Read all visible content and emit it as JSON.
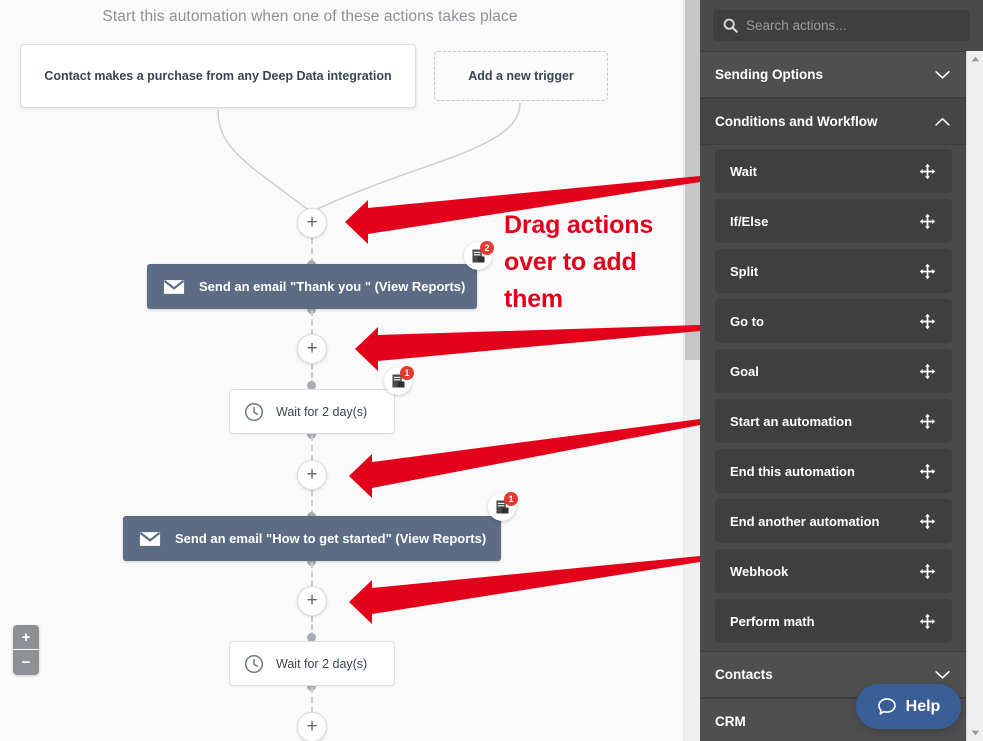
{
  "canvas": {
    "header": "Start this automation when one of these actions takes place",
    "triggers": [
      {
        "label": "Contact makes a purchase from any Deep Data integration",
        "style": "solid"
      },
      {
        "label": "Add a new trigger",
        "style": "dashed"
      }
    ],
    "nodes": [
      {
        "type": "email",
        "label": "Send an email \"Thank you \" (View Reports)",
        "reports": "2"
      },
      {
        "type": "wait",
        "label": "Wait for 2 day(s)",
        "reports": "1"
      },
      {
        "type": "email",
        "label": "Send an email \"How to get started\" (View Reports)",
        "reports": "1"
      },
      {
        "type": "wait",
        "label": "Wait for 2 day(s)",
        "reports": ""
      }
    ],
    "add_node_label": "+",
    "zoom_in_label": "+",
    "zoom_out_label": "−"
  },
  "annotation": {
    "text": "Drag actions over to add them",
    "color": "#e2001a",
    "arrow_count": 4
  },
  "sidebar": {
    "search": {
      "placeholder": "Search actions...",
      "value": "",
      "icon": "search-icon"
    },
    "sections": [
      {
        "title": "Sending Options",
        "expanded": false,
        "items": []
      },
      {
        "title": "Conditions and Workflow",
        "expanded": true,
        "items": [
          {
            "label": "Wait"
          },
          {
            "label": "If/Else"
          },
          {
            "label": "Split"
          },
          {
            "label": "Go to"
          },
          {
            "label": "Goal"
          },
          {
            "label": "Start an automation"
          },
          {
            "label": "End this automation"
          },
          {
            "label": "End another automation"
          },
          {
            "label": "Webhook"
          },
          {
            "label": "Perform math"
          }
        ]
      },
      {
        "title": "Contacts",
        "expanded": false,
        "items": []
      },
      {
        "title": "CRM",
        "expanded": false,
        "items": []
      }
    ]
  },
  "help": {
    "label": "Help",
    "icon": "chat-bubble-icon",
    "color": "#3a5e96"
  },
  "colors": {
    "canvas_bg": "#fafafa",
    "sidebar_bg": "#4a4a4a",
    "sidebar_item_bg": "#3f3f3f",
    "email_block": "#5c6c84",
    "badge_red": "#e03a33",
    "annotation_red": "#e2001a"
  }
}
